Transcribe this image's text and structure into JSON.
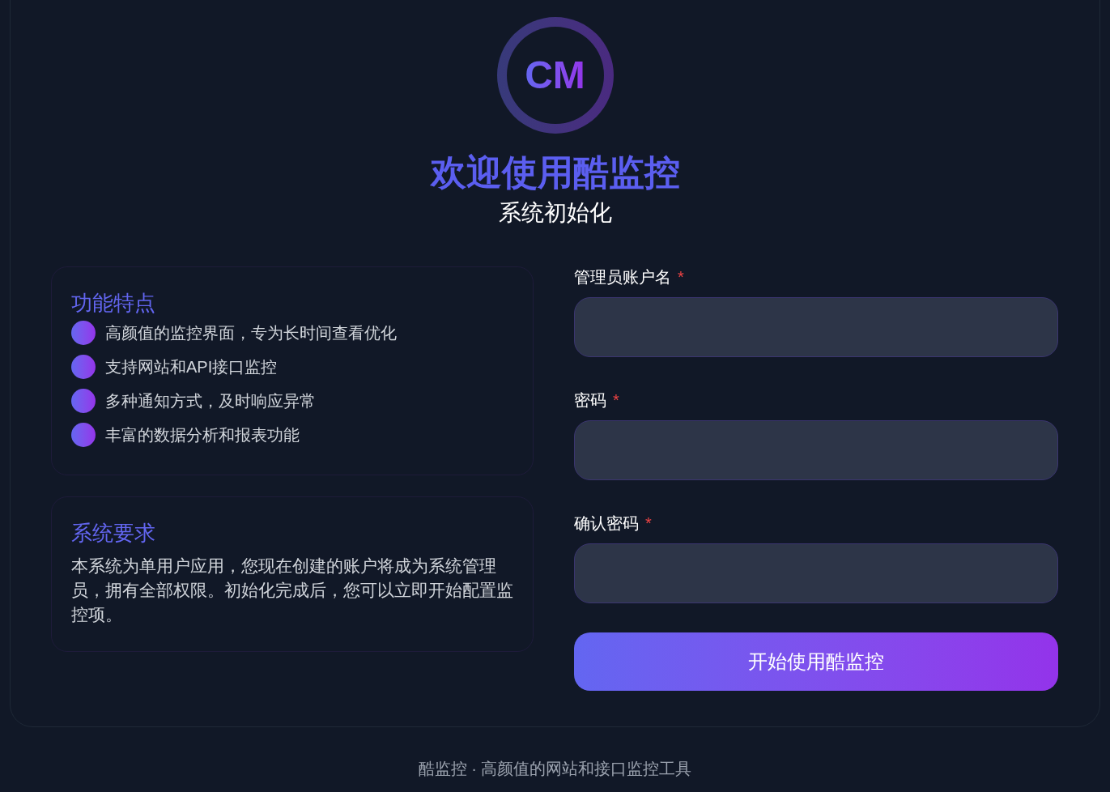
{
  "logo": {
    "text": "CM"
  },
  "title": "欢迎使用酷监控",
  "subtitle": "系统初始化",
  "features": {
    "title": "功能特点",
    "items": [
      "高颜值的监控界面，专为长时间查看优化",
      "支持网站和API接口监控",
      "多种通知方式，及时响应异常",
      "丰富的数据分析和报表功能"
    ]
  },
  "requirements": {
    "title": "系统要求",
    "text": "本系统为单用户应用，您现在创建的账户将成为系统管理员，拥有全部权限。初始化完成后，您可以立即开始配置监控项。"
  },
  "form": {
    "fields": [
      {
        "label": "管理员账户名",
        "required_mark": "*"
      },
      {
        "label": "密码",
        "required_mark": "*"
      },
      {
        "label": "确认密码",
        "required_mark": "*"
      }
    ],
    "submit": "开始使用酷监控"
  },
  "footer": "酷监控 · 高颜值的网站和接口监控工具"
}
